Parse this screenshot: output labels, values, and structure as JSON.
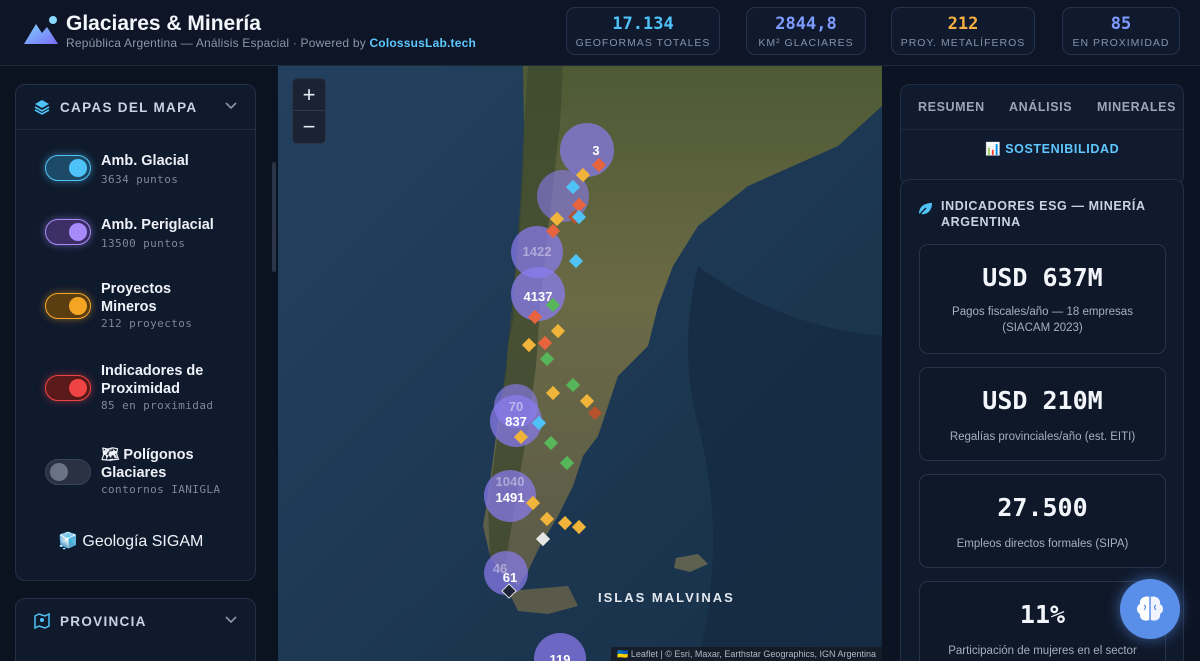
{
  "header": {
    "title": "Glaciares & Minería",
    "subtitle": "República Argentina — Análisis Espacial · Powered by ",
    "brand": "ColossusLab.tech",
    "stats": [
      {
        "value": "17.134",
        "label": "GEOFORMAS TOTALES",
        "color": "#4fc3f7"
      },
      {
        "value": "2844,8",
        "label": "KM² GLACIARES",
        "color": "#7f9cff"
      },
      {
        "value": "212",
        "label": "PROY. METALÍFEROS",
        "color": "#f5b041"
      },
      {
        "value": "85",
        "label": "EN PROXIMIDAD",
        "color": "#7f9cff"
      }
    ]
  },
  "sidebar": {
    "layers_title": "CAPAS DEL MAPA",
    "layers": [
      {
        "name": "Amb. Glacial",
        "count": "3634 puntos",
        "on": true,
        "color": "#4fc3f7"
      },
      {
        "name": "Amb. Periglacial",
        "count": "13500 puntos",
        "on": true,
        "color": "#a78bfa"
      },
      {
        "name": "Proyectos Mineros",
        "count": "212 proyectos",
        "on": true,
        "color": "#f5a524"
      },
      {
        "name": "Indicadores de Proximidad",
        "count": "85 en proximidad",
        "on": true,
        "color": "#ef4444"
      },
      {
        "name": "🗺 Polígonos Glaciares",
        "count": "contornos IANIGLA",
        "on": false,
        "color": "#6a7386"
      }
    ],
    "geology": "🧊 Geología SIGAM",
    "province_title": "PROVINCIA"
  },
  "map": {
    "zoom_in": "+",
    "zoom_out": "−",
    "label": "ISLAS MALVINAS",
    "attribution": "🇺🇦 Leaflet | © Esri, Maxar, Earthstar Geographics, IGN Argentina",
    "clusters": [
      "3",
      "1422",
      "4137",
      "70",
      "837",
      "1040",
      "1491",
      "46",
      "61",
      "119"
    ]
  },
  "right_panel": {
    "tabs": [
      "RESUMEN",
      "ANÁLISIS",
      "MINERALES",
      "📊 SOSTENIBILIDAD"
    ],
    "esg_title": "INDICADORES ESG — MINERÍA ARGENTINA",
    "indicators": [
      {
        "value": "USD 637M",
        "desc": "Pagos fiscales/año — 18 empresas (SIACAM 2023)"
      },
      {
        "value": "USD 210M",
        "desc": "Regalías provinciales/año (est. EITI)"
      },
      {
        "value": "27.500",
        "desc": "Empleos directos formales (SIPA)"
      },
      {
        "value": "11%",
        "desc": "Participación de mujeres en el sector"
      }
    ]
  }
}
